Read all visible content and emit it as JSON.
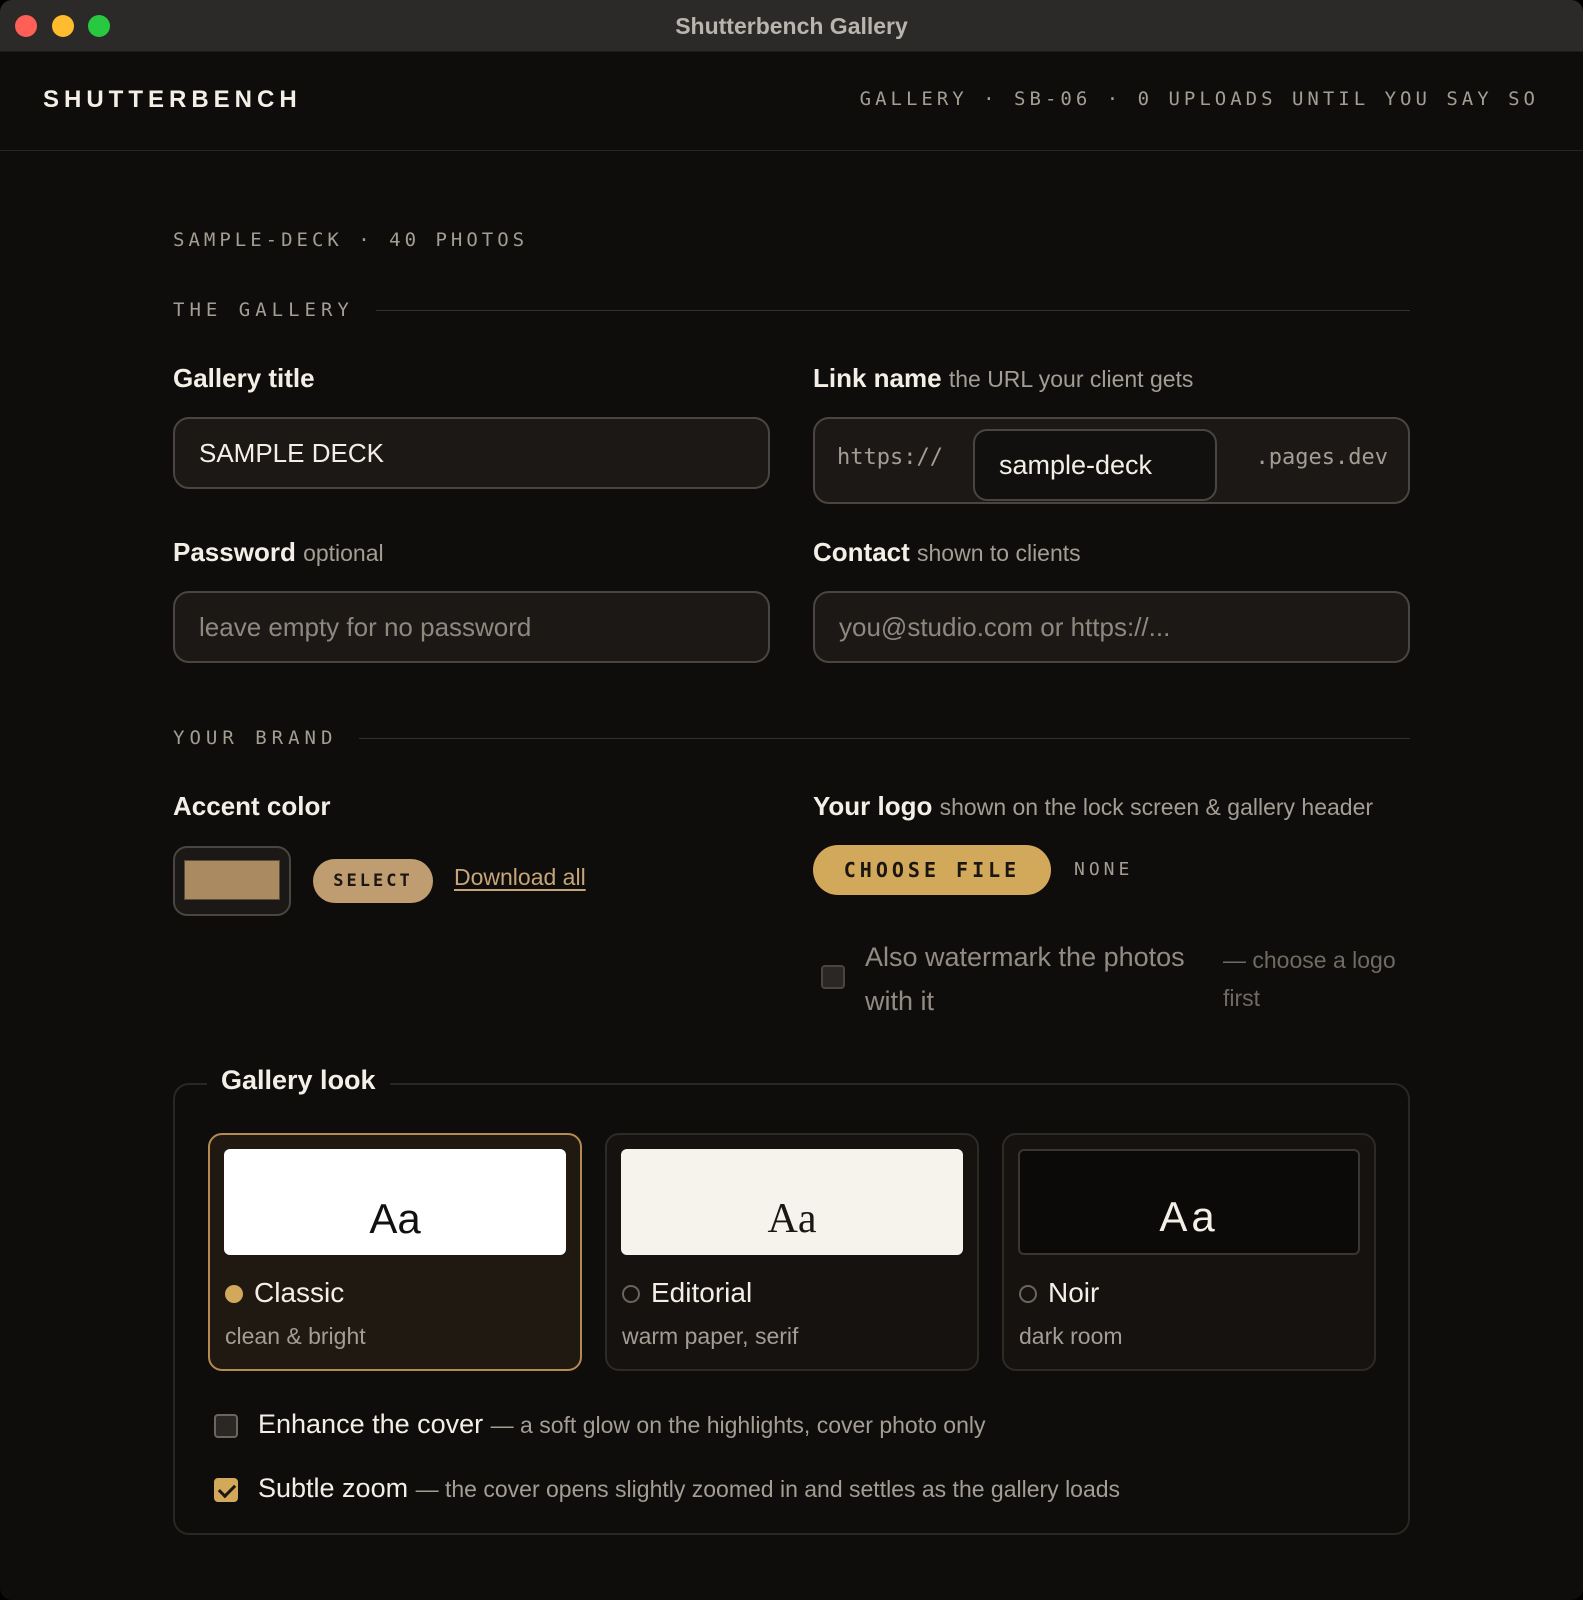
{
  "window": {
    "title": "Shutterbench Gallery"
  },
  "nav": {
    "brand": "SHUTTERBENCH",
    "meta": "GALLERY · SB-06 · 0 UPLOADS UNTIL YOU SAY SO"
  },
  "deck": {
    "meta": "SAMPLE-DECK · 40 PHOTOS"
  },
  "sections": {
    "gallery": "THE GALLERY",
    "brand": "YOUR BRAND"
  },
  "gallery_title": {
    "label": "Gallery title",
    "value": "SAMPLE DECK"
  },
  "link_name": {
    "label": "Link name",
    "hint": "the URL your client gets",
    "prefix": "https://",
    "slug": "sample-deck",
    "suffix": ".pages.dev"
  },
  "password": {
    "label": "Password",
    "hint": "optional",
    "placeholder": "leave empty for no password"
  },
  "contact": {
    "label": "Contact",
    "hint": "shown to clients",
    "placeholder": "you@studio.com or https://..."
  },
  "accent": {
    "label": "Accent color",
    "color": "#a98a61",
    "select_label": "SELECT",
    "download_label": "Download all"
  },
  "logo": {
    "label": "Your logo",
    "hint": "shown on the lock screen & gallery header",
    "choose_label": "CHOOSE FILE",
    "file_status": "NONE",
    "watermark_label": "Also watermark the photos with it",
    "watermark_hint": "— choose a logo first",
    "watermark_checked": false
  },
  "look": {
    "legend": "Gallery look",
    "options": [
      {
        "preview": "Aa",
        "name": "Classic",
        "desc": "clean & bright",
        "selected": true
      },
      {
        "preview": "Aa",
        "name": "Editorial",
        "desc": "warm paper, serif",
        "selected": false
      },
      {
        "preview": "Aa",
        "name": "Noir",
        "desc": "dark room",
        "selected": false
      }
    ],
    "enhance": {
      "label": "Enhance the cover",
      "hint": "— a soft glow on the highlights, cover photo only",
      "checked": false
    },
    "zoom": {
      "label": "Subtle zoom",
      "hint": "— the cover opens slightly zoomed in and settles as the gallery loads",
      "checked": true
    }
  },
  "colors": {
    "accent_gold": "#d2a85b",
    "background": "#0f0d0b",
    "link": "#c6a679"
  }
}
